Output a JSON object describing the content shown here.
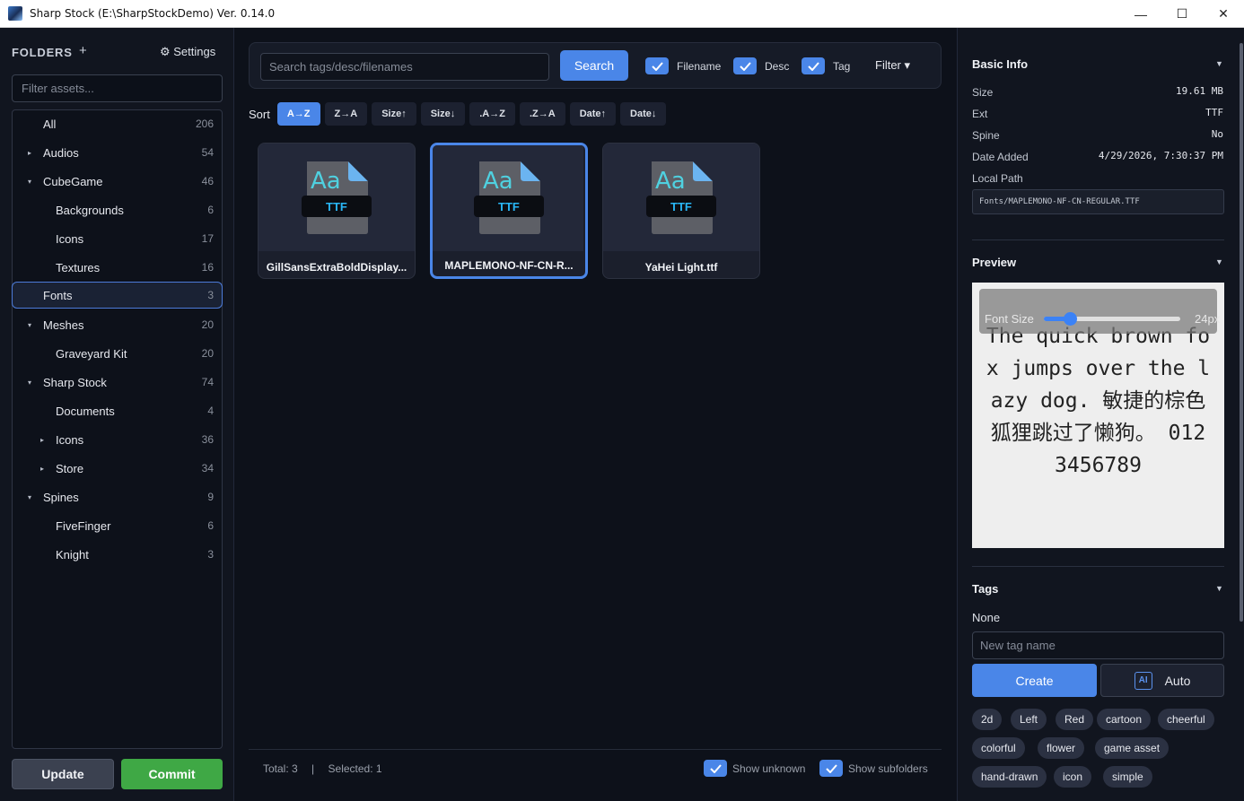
{
  "window": {
    "title": "Sharp Stock (E:\\SharpStockDemo) Ver. 0.14.0",
    "minimize": "—",
    "maximize": "☐",
    "close": "✕"
  },
  "sidebar": {
    "header": "FOLDERS",
    "add": "+",
    "settings": "⚙ Settings",
    "filter_placeholder": "Filter assets...",
    "items": [
      {
        "label": "All",
        "count": "206",
        "caret": ""
      },
      {
        "label": "Audios",
        "count": "54",
        "caret": "▸"
      },
      {
        "label": "CubeGame",
        "count": "46",
        "caret": "▾"
      },
      {
        "label": "Backgrounds",
        "count": "6",
        "caret": ""
      },
      {
        "label": "Icons",
        "count": "17",
        "caret": ""
      },
      {
        "label": "Textures",
        "count": "16",
        "caret": ""
      },
      {
        "label": "Fonts",
        "count": "3",
        "caret": ""
      },
      {
        "label": "Meshes",
        "count": "20",
        "caret": "▾"
      },
      {
        "label": "Graveyard Kit",
        "count": "20",
        "caret": ""
      },
      {
        "label": "Sharp Stock",
        "count": "74",
        "caret": "▾"
      },
      {
        "label": "Documents",
        "count": "4",
        "caret": ""
      },
      {
        "label": "Icons",
        "count": "36",
        "caret": "▸"
      },
      {
        "label": "Store",
        "count": "34",
        "caret": "▸"
      },
      {
        "label": "Spines",
        "count": "9",
        "caret": "▾"
      },
      {
        "label": "FiveFinger",
        "count": "6",
        "caret": ""
      },
      {
        "label": "Knight",
        "count": "3",
        "caret": ""
      }
    ],
    "update": "Update",
    "commit": "Commit"
  },
  "search": {
    "placeholder": "Search tags/desc/filenames",
    "button": "Search",
    "filename": "Filename",
    "desc": "Desc",
    "tag": "Tag",
    "filter": "Filter ▾"
  },
  "sort": {
    "label": "Sort",
    "options": [
      "A→Z",
      "Z→A",
      "Size↑",
      "Size↓",
      ".A→Z",
      ".Z→A",
      "Date↑",
      "Date↓"
    ]
  },
  "assets": [
    {
      "name": "GillSansExtraBoldDisplay...",
      "glyph": "Aa",
      "ext": "TTF"
    },
    {
      "name": "MAPLEMONO-NF-CN-R...",
      "glyph": "Aa",
      "ext": "TTF"
    },
    {
      "name": "YaHei Light.ttf",
      "glyph": "Aa",
      "ext": "TTF"
    }
  ],
  "status": {
    "total": "Total: 3",
    "sep": "|",
    "selected": "Selected: 1",
    "show_unknown": "Show unknown",
    "show_subfolders": "Show subfolders"
  },
  "info": {
    "title": "Basic Info",
    "size_label": "Size",
    "size": "19.61 MB",
    "ext_label": "Ext",
    "ext": "TTF",
    "spine_label": "Spine",
    "spine": "No",
    "date_label": "Date Added",
    "date": "4/29/2026, 7:30:37 PM",
    "path_label": "Local Path",
    "path": "Fonts/MAPLEMONO-NF-CN-REGULAR.TTF"
  },
  "preview": {
    "title": "Preview",
    "font_size_label": "Font Size",
    "font_size_value": "24px",
    "font_size_fraction": 0.2,
    "text": "The quick brown fox jumps over the lazy dog. 敏捷的棕色狐狸跳过了懒狗。 0123456789"
  },
  "tags": {
    "title": "Tags",
    "none": "None",
    "placeholder": "New tag name",
    "create": "Create",
    "auto_icon": "AI",
    "auto": "Auto",
    "chips": [
      "2d",
      "Left",
      "Red",
      "cartoon",
      "cheerful",
      "colorful",
      "flower",
      "game asset",
      "hand-drawn",
      "icon",
      "simple"
    ]
  },
  "colors": {
    "accent": "#4a86e8",
    "commit": "#3fa845",
    "ttf_text": "#29b6f6"
  }
}
